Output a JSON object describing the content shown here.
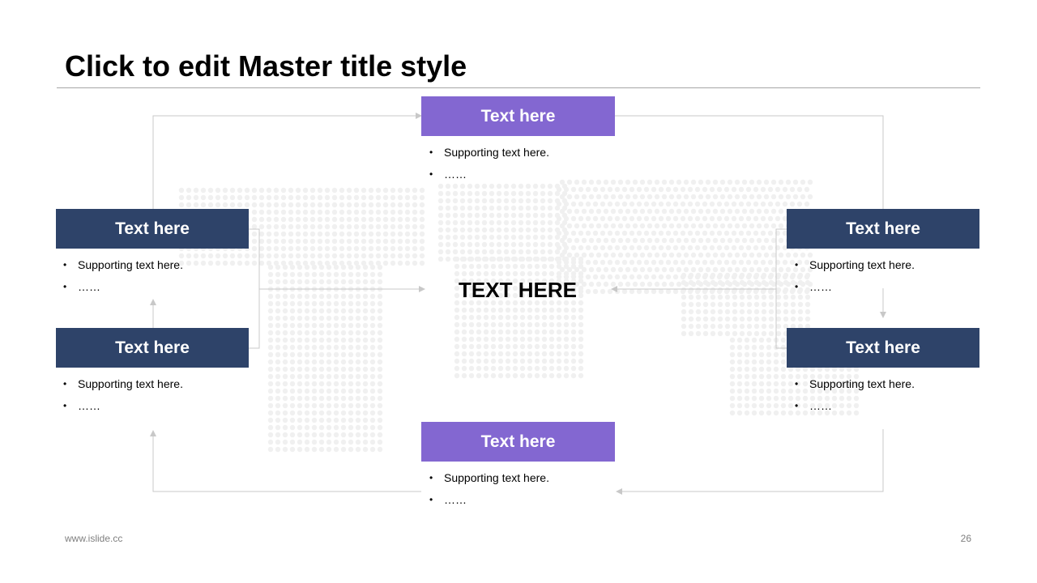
{
  "title": "Click to edit Master title style",
  "center_label": "TEXT HERE",
  "footer": {
    "website": "www.islide.cc",
    "page_number": "26"
  },
  "colors": {
    "navy": "#2e4369",
    "purple": "#8367d1",
    "connector": "#c8c8c8",
    "map_dots": "#f0f0f0"
  },
  "nodes": {
    "top": {
      "heading": "Text here",
      "bullets": [
        "Supporting text here.",
        "……"
      ]
    },
    "left_upper": {
      "heading": "Text here",
      "bullets": [
        "Supporting text here.",
        "……"
      ]
    },
    "left_lower": {
      "heading": "Text here",
      "bullets": [
        "Supporting text here.",
        "……"
      ]
    },
    "right_upper": {
      "heading": "Text here",
      "bullets": [
        "Supporting text here.",
        "……"
      ]
    },
    "right_lower": {
      "heading": "Text here",
      "bullets": [
        "Supporting text here.",
        "……"
      ]
    },
    "bottom": {
      "heading": "Text here",
      "bullets": [
        "Supporting text here.",
        "……"
      ]
    }
  }
}
